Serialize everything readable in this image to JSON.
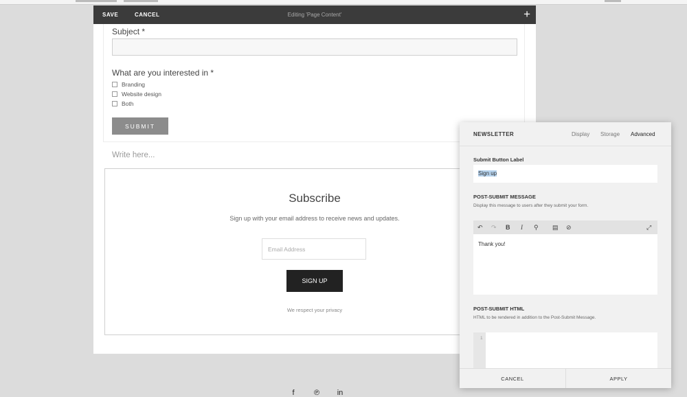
{
  "editbar": {
    "save": "SAVE",
    "cancel": "CANCEL",
    "title": "Editing 'Page Content'",
    "add_icon": "+"
  },
  "form": {
    "subject_label": "Subject *",
    "interest_label": "What are you interested in *",
    "options": [
      "Branding",
      "Website design",
      "Both"
    ],
    "submit": "SUBMIT"
  },
  "write_placeholder": "Write here...",
  "subscribe": {
    "title": "Subscribe",
    "description": "Sign up with your email address to receive news and updates.",
    "email_placeholder": "Email Address",
    "button": "SIGN UP",
    "privacy": "We respect your privacy"
  },
  "footer": {
    "icons": [
      "facebook-icon",
      "pinterest-icon",
      "linkedin-icon"
    ],
    "glyphs": [
      "f",
      "℗",
      "in"
    ]
  },
  "panel": {
    "title": "NEWSLETTER",
    "tabs": [
      "Display",
      "Storage",
      "Advanced"
    ],
    "active_tab": "Advanced",
    "submit_label_heading": "Submit Button Label",
    "submit_label_value": "Sign up",
    "post_msg_heading": "POST-SUBMIT MESSAGE",
    "post_msg_desc": "Display this message to users after they submit your form.",
    "toolbar_icons": [
      "undo-icon",
      "redo-icon",
      "bold-icon",
      "italic-icon",
      "link-icon",
      "paste-icon",
      "clear-format-icon",
      "expand-icon"
    ],
    "toolbar_glyphs": [
      "↶",
      "↷",
      "B",
      "I",
      "⚲",
      "▤",
      "⊘",
      "⤢"
    ],
    "message_text": "Thank you!",
    "post_html_heading": "POST-SUBMIT HTML",
    "post_html_desc": "HTML to be rendered in addition to the Post-Submit Message.",
    "line_number": "1",
    "cancel": "CANCEL",
    "apply": "APPLY"
  },
  "colors": {
    "editbar_bg": "#3b3b3b",
    "signup_bg": "#222222",
    "submit_bg": "#8c8c8c",
    "selection": "#b6d3ee"
  }
}
